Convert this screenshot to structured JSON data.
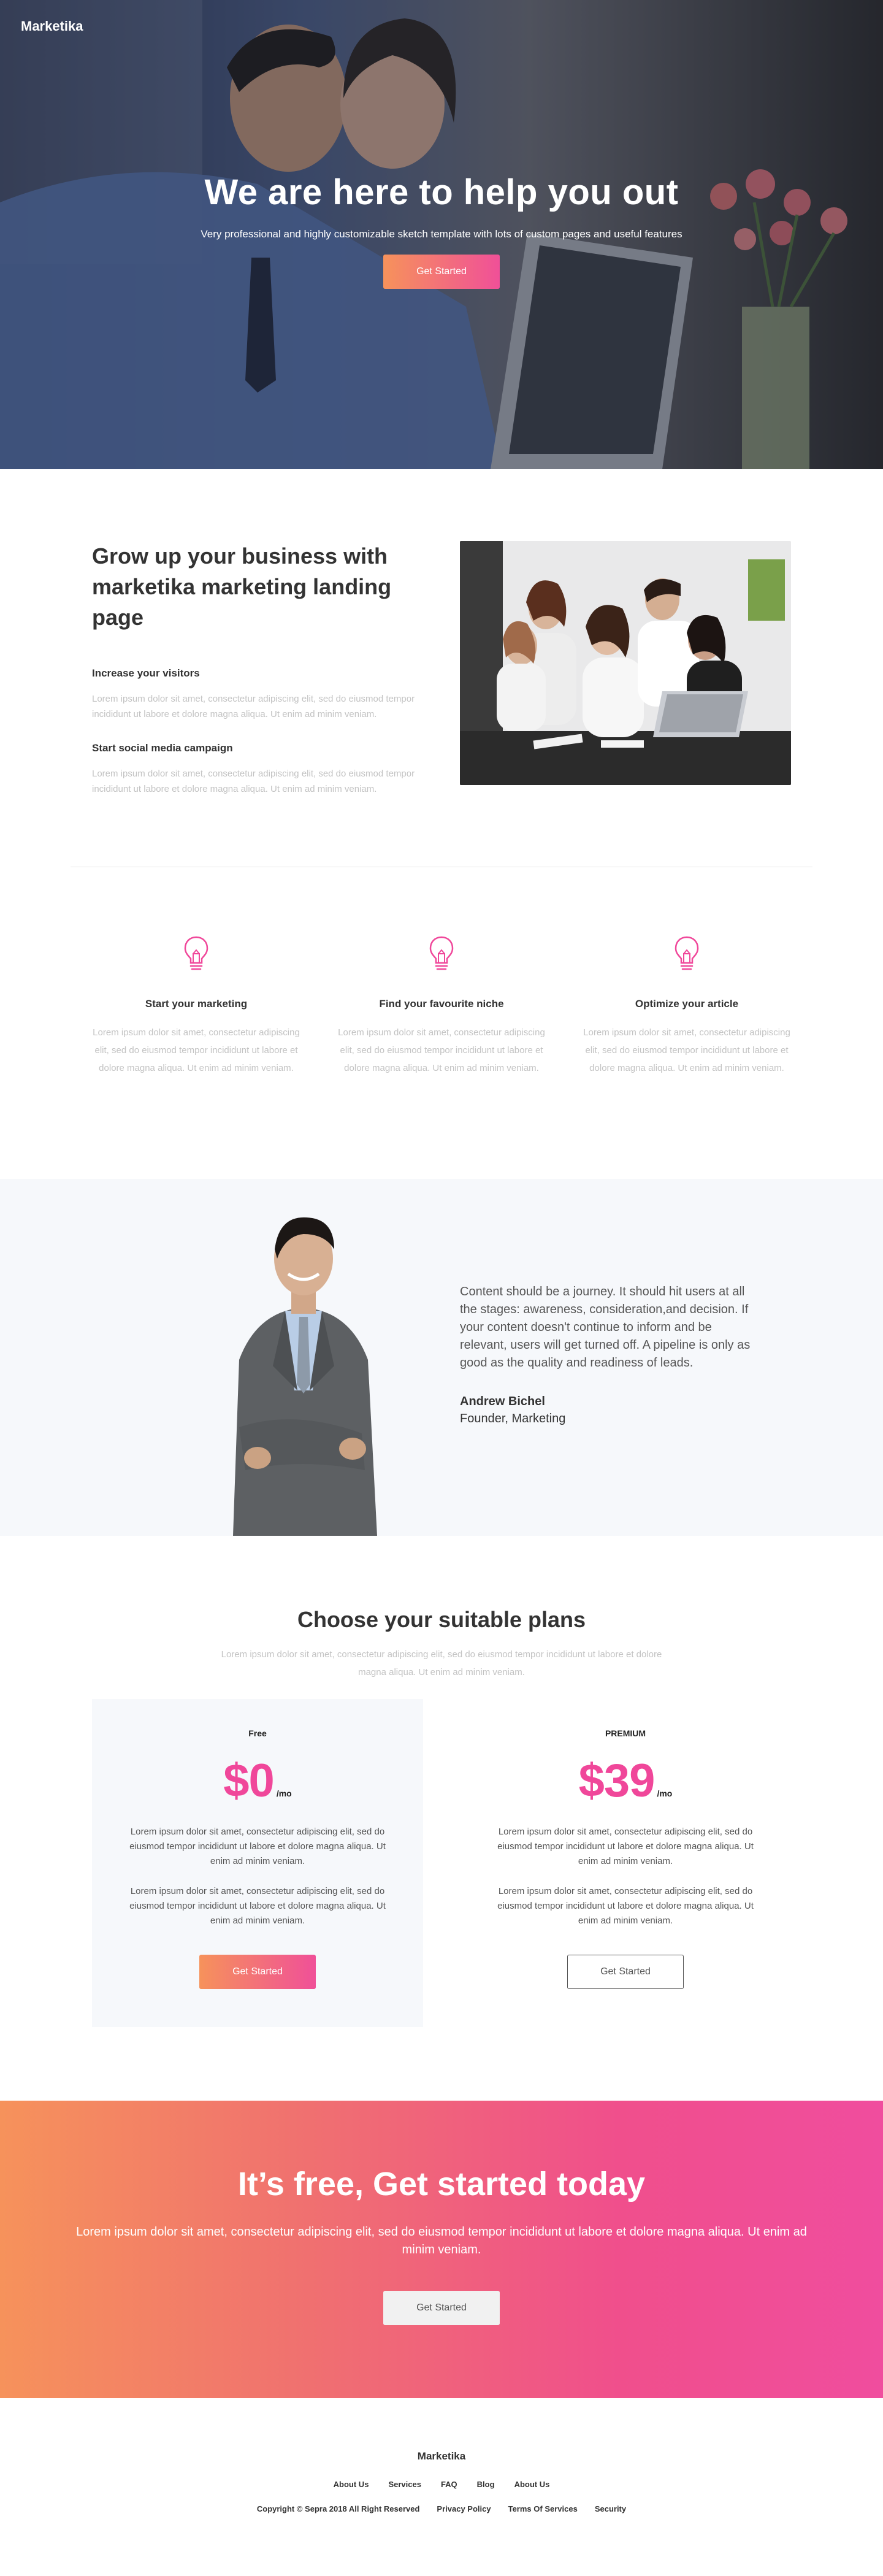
{
  "brand": "Marketika",
  "hero": {
    "title": "We are here to help you out",
    "subtitle": "Very professional and highly customizable sketch template with lots of custom pages and useful features",
    "cta_label": "Get Started"
  },
  "grow": {
    "title": "Grow up your business with marketika marketing landing page",
    "features": [
      {
        "heading": "Increase your visitors",
        "text": "Lorem ipsum dolor sit amet, consectetur adipiscing elit, sed do eiusmod tempor incididunt ut labore et dolore magna aliqua. Ut enim ad minim veniam."
      },
      {
        "heading": "Start social media campaign",
        "text": "Lorem ipsum dolor sit amet, consectetur adipiscing elit, sed do eiusmod tempor incididunt ut labore et dolore magna aliqua. Ut enim ad minim veniam."
      }
    ]
  },
  "features": [
    {
      "icon": "lightbulb-icon",
      "title": "Start your marketing",
      "text": "Lorem ipsum dolor sit amet, consectetur adipiscing elit, sed do eiusmod tempor incididunt ut labore et dolore magna aliqua. Ut enim ad minim veniam."
    },
    {
      "icon": "lightbulb-icon",
      "title": "Find your favourite niche",
      "text": "Lorem ipsum dolor sit amet, consectetur adipiscing elit, sed do eiusmod tempor incididunt ut labore et dolore magna aliqua. Ut enim ad minim veniam."
    },
    {
      "icon": "lightbulb-icon",
      "title": "Optimize your article",
      "text": "Lorem ipsum dolor sit amet, consectetur adipiscing elit, sed do eiusmod tempor incididunt ut labore et dolore magna aliqua. Ut enim ad minim veniam."
    }
  ],
  "testimonial": {
    "quote": "Content should be a journey. It should hit users at all the stages: awareness, consideration,and decision. If your content doesn't continue to inform and be relevant, users will get turned off. A pipeline is only as good as the quality and readiness of leads.",
    "name": "Andrew Bichel",
    "role": "Founder, Marketing"
  },
  "plans": {
    "title": "Choose your suitable plans",
    "subtitle": "Lorem ipsum dolor sit amet, consectetur adipiscing elit, sed do eiusmod tempor incididunt ut labore et dolore magna aliqua. Ut enim ad minim veniam.",
    "items": [
      {
        "name": "Free",
        "price": "$0",
        "period": "/mo",
        "para1": "Lorem ipsum dolor sit amet, consectetur adipiscing elit, sed do eiusmod tempor incididunt ut labore et dolore magna aliqua. Ut enim ad minim veniam.",
        "para2": "Lorem ipsum dolor sit amet, consectetur adipiscing elit, sed do eiusmod tempor incididunt ut labore et dolore magna aliqua. Ut enim ad minim veniam.",
        "cta_label": "Get Started"
      },
      {
        "name": "PREMIUM",
        "price": "$39",
        "period": "/mo",
        "para1": "Lorem ipsum dolor sit amet, consectetur adipiscing elit, sed do eiusmod tempor incididunt ut labore et dolore magna aliqua. Ut enim ad minim veniam.",
        "para2": "Lorem ipsum dolor sit amet, consectetur adipiscing elit, sed do eiusmod tempor incididunt ut labore et dolore magna aliqua. Ut enim ad minim veniam.",
        "cta_label": "Get Started"
      }
    ]
  },
  "cta": {
    "title": "It’s free, Get started today",
    "text": "Lorem ipsum dolor sit amet, consectetur adipiscing elit, sed do eiusmod tempor incididunt ut labore et dolore magna aliqua. Ut enim ad minim veniam.",
    "button_label": "Get Started"
  },
  "footer": {
    "brand": "Marketika",
    "nav": [
      "About Us",
      "Services",
      "FAQ",
      "Blog",
      "About Us"
    ],
    "copyright": "Copyright © Sepra 2018 All Right Reserved",
    "legal": [
      "Privacy Policy",
      "Terms Of Services",
      "Security"
    ]
  },
  "colors": {
    "accent_pink": "#f0479a",
    "accent_orange": "#f6925b",
    "light_bg": "#f6f8fb"
  }
}
